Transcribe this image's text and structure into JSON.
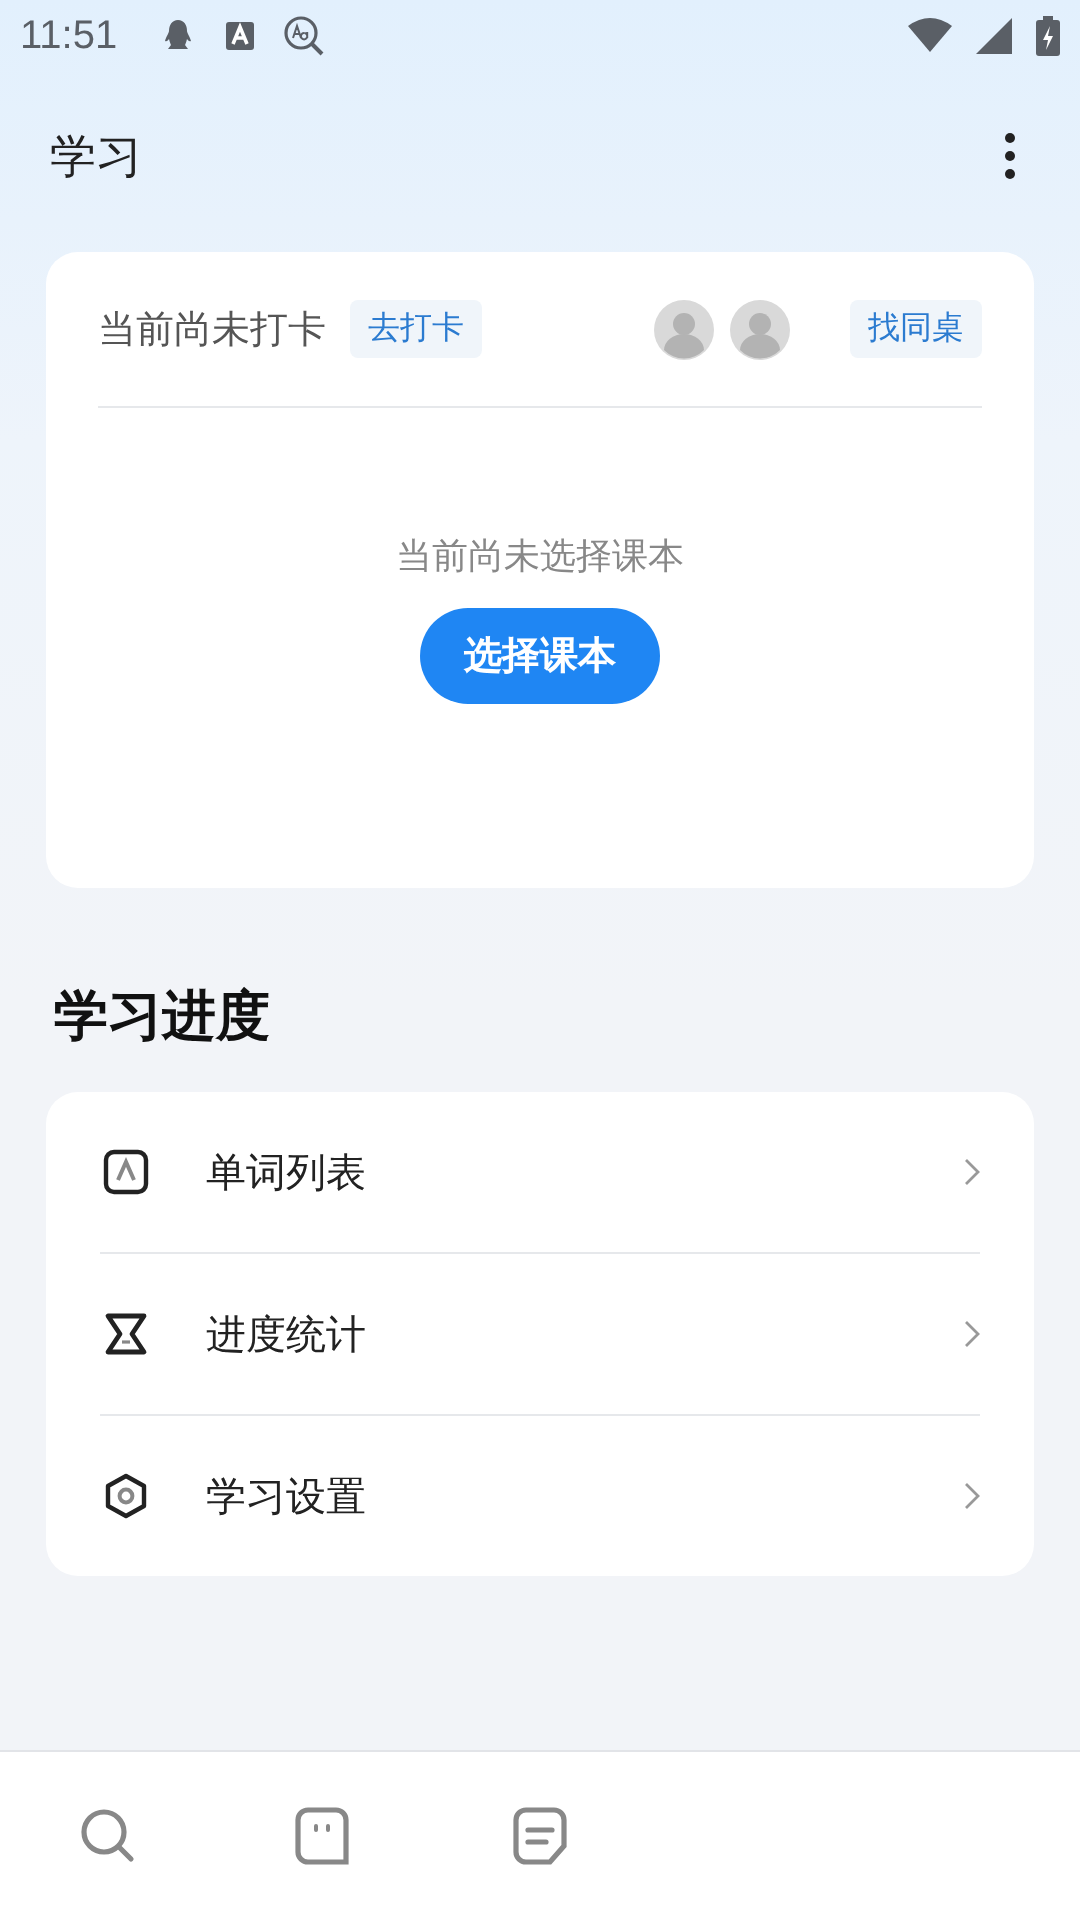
{
  "status_bar": {
    "time": "11:51"
  },
  "header": {
    "title": "学习"
  },
  "checkin_card": {
    "status": "当前尚未打卡",
    "checkin_button": "去打卡",
    "find_partner_button": "找同桌",
    "empty_message": "当前尚未选择课本",
    "choose_button": "选择课本"
  },
  "section_title": "学习进度",
  "menu": [
    {
      "kind": "words",
      "label": "单词列表"
    },
    {
      "kind": "stats",
      "label": "进度统计"
    },
    {
      "kind": "settings",
      "label": "学习设置"
    }
  ],
  "tab_bar": [
    {
      "kind": "search"
    },
    {
      "kind": "chat"
    },
    {
      "kind": "note"
    }
  ]
}
